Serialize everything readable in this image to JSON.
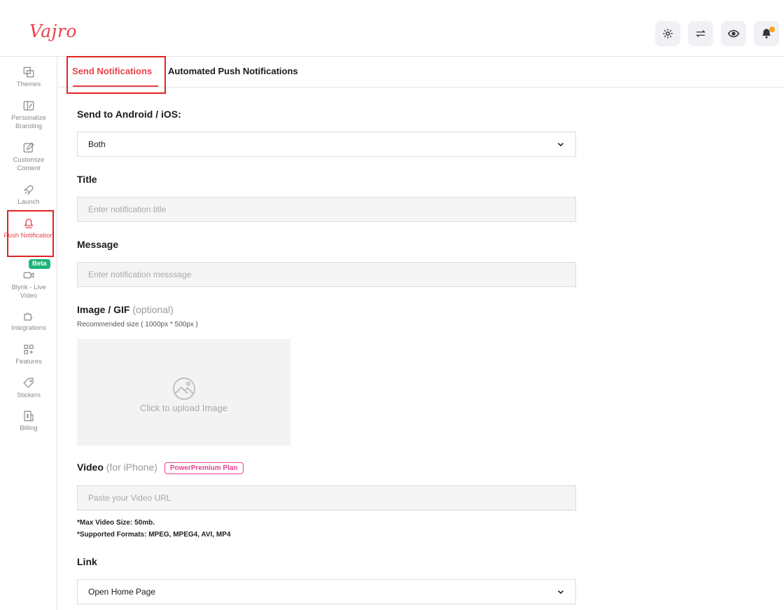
{
  "header": {
    "logo": "Vajro",
    "actions": [
      {
        "icon": "settings-icon"
      },
      {
        "icon": "switch-icon"
      },
      {
        "icon": "preview-eye-icon"
      },
      {
        "icon": "notification-bell-icon"
      }
    ],
    "notification_dot_color": "#f7a41d"
  },
  "sidebar": {
    "items": [
      {
        "label": "Themes",
        "icon": "themes-icon"
      },
      {
        "label": "Personalize Branding",
        "icon": "branding-icon"
      },
      {
        "label": "Customize Content",
        "icon": "edit-icon"
      },
      {
        "label": "Launch",
        "icon": "rocket-icon"
      },
      {
        "label": "Push Notification",
        "icon": "bell-icon",
        "active": true
      },
      {
        "label": "Blynk - Live Video",
        "icon": "video-icon",
        "badge": "Beta"
      },
      {
        "label": "Integrations",
        "icon": "puzzle-icon"
      },
      {
        "label": "Features",
        "icon": "features-grid-icon"
      },
      {
        "label": "Stickers",
        "icon": "tag-icon"
      },
      {
        "label": "Billing",
        "icon": "billing-icon"
      }
    ]
  },
  "tabs": [
    {
      "label": "Send Notifications",
      "active": true
    },
    {
      "label": "Automated Push Notifications",
      "active": false
    }
  ],
  "form": {
    "platform_label": "Send to Android / iOS:",
    "platform_value": "Both",
    "title_label": "Title",
    "title_placeholder": "Enter notification title",
    "message_label": "Message",
    "message_placeholder": "Enter notification messsage",
    "image_label": "Image / GIF",
    "image_optional": "(optional)",
    "image_hint": "Recommended size ( 1000px * 500px )",
    "upload_text": "Click to upload Image",
    "video_label": "Video",
    "video_sub": "(for iPhone)",
    "video_badge": "PowerPremium Plan",
    "video_placeholder": "Paste your Video URL",
    "video_note_size": "*Max Video Size: 50mb.",
    "video_note_formats": "*Supported Formats: MPEG, MPEG4, AVI, MP4",
    "link_label": "Link",
    "link_value": "Open Home Page"
  },
  "colors": {
    "accent": "#e8434c",
    "highlight_box": "#e02424",
    "beta_badge": "#1fb377",
    "premium_badge": "#e8438f"
  }
}
